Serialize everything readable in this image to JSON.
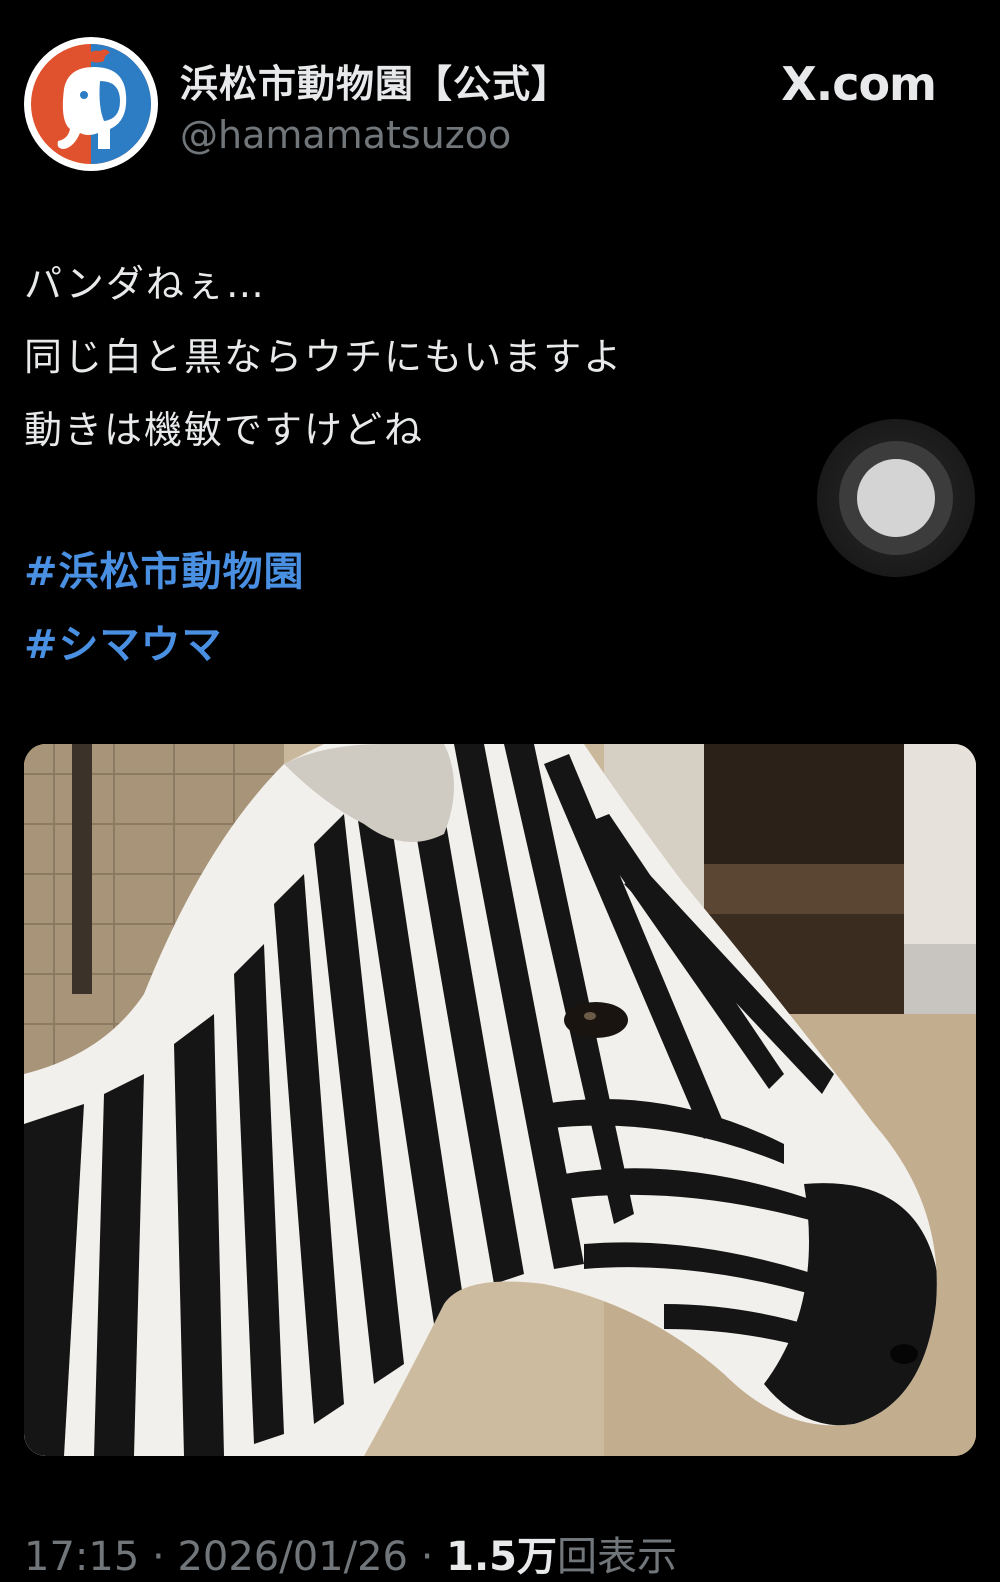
{
  "account": {
    "name": "浜松市動物園【公式】",
    "handle": "@hamamatsuzoo",
    "avatar_icon": "elephant-logo-icon"
  },
  "site_label": "X.com",
  "post": {
    "lines": [
      "パンダねぇ…",
      "同じ白と黒ならウチにもいますよ",
      "動きは機敏ですけどね"
    ],
    "hashtags": [
      "#浜松市動物園",
      "#シマウマ"
    ]
  },
  "meta": {
    "time": "17:15",
    "separator": " · ",
    "date": "2026/01/26",
    "views_count": "1.5万",
    "views_label": "回表示"
  },
  "colors": {
    "background": "#000000",
    "text": "#e7e9ea",
    "secondary": "#71767b",
    "hashtag": "#4a90e2",
    "avatar_red": "#e0522d",
    "avatar_blue": "#2c7dc3"
  }
}
